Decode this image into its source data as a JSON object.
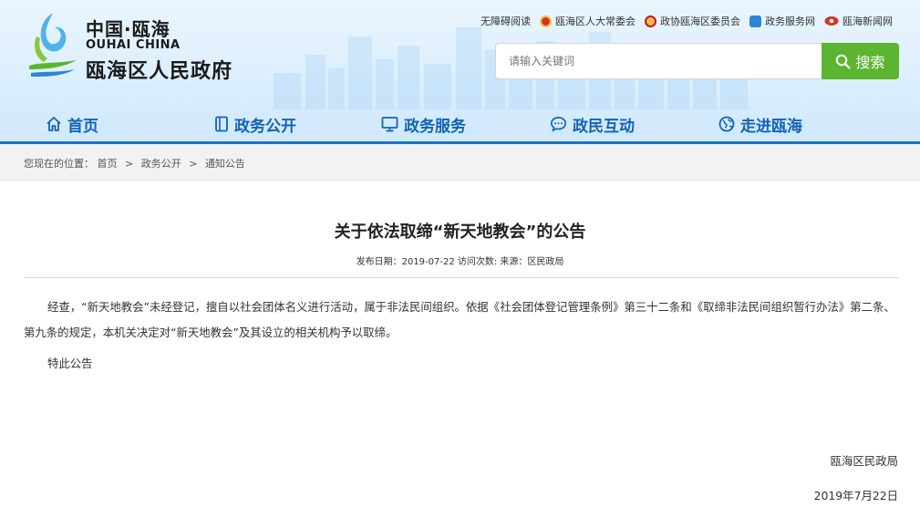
{
  "site": {
    "logo_cn_top": "中国·瓯海",
    "logo_en": "OUHAI CHINA",
    "logo_cn_main": "瓯海区人民政府"
  },
  "toplinks": [
    {
      "label": "无障碍阅读",
      "icon": "none"
    },
    {
      "label": "瓯海区人大常委会",
      "icon": "national-emblem-icon",
      "color": "#d8302a"
    },
    {
      "label": "政协瓯海区委员会",
      "icon": "cppcc-emblem-icon",
      "color": "#c8102e"
    },
    {
      "label": "政务服务网",
      "icon": "service-network-icon",
      "color": "#2a86d8"
    },
    {
      "label": "瓯海新闻网",
      "icon": "news-eye-icon",
      "color": "#d8302a"
    }
  ],
  "search": {
    "placeholder": "请输入关键词",
    "button_label": "搜索"
  },
  "nav": [
    {
      "label": "首页",
      "icon": "home-icon"
    },
    {
      "label": "政务公开",
      "icon": "document-icon"
    },
    {
      "label": "政务服务",
      "icon": "monitor-icon"
    },
    {
      "label": "政民互动",
      "icon": "chat-icon"
    },
    {
      "label": "走进瓯海",
      "icon": "globe-icon"
    }
  ],
  "breadcrumb": {
    "prefix": "您现在的位置：",
    "items": [
      "首页",
      "政务公开",
      "通知公告"
    ],
    "separator": ">"
  },
  "article": {
    "title": "关于依法取缔“新天地教会”的公告",
    "meta": "发布日期：2019-07-22 访问次数: 来源：区民政局",
    "paragraph1": "经查，“新天地教会”未经登记，擅自以社会团体名义进行活动，属于非法民间组织。依据《社会团体登记管理条例》第三十二条和《取缔非法民间组织暂行办法》第二条、第九条的规定，本机关决定对“新天地教会”及其设立的相关机构予以取缔。",
    "paragraph2": "特此公告",
    "signature": "瓯海区民政局",
    "date": "2019年7月22日"
  },
  "colors": {
    "nav_text": "#1363b6",
    "nav_line": "#1e73c4",
    "search_button": "#5cb531"
  }
}
